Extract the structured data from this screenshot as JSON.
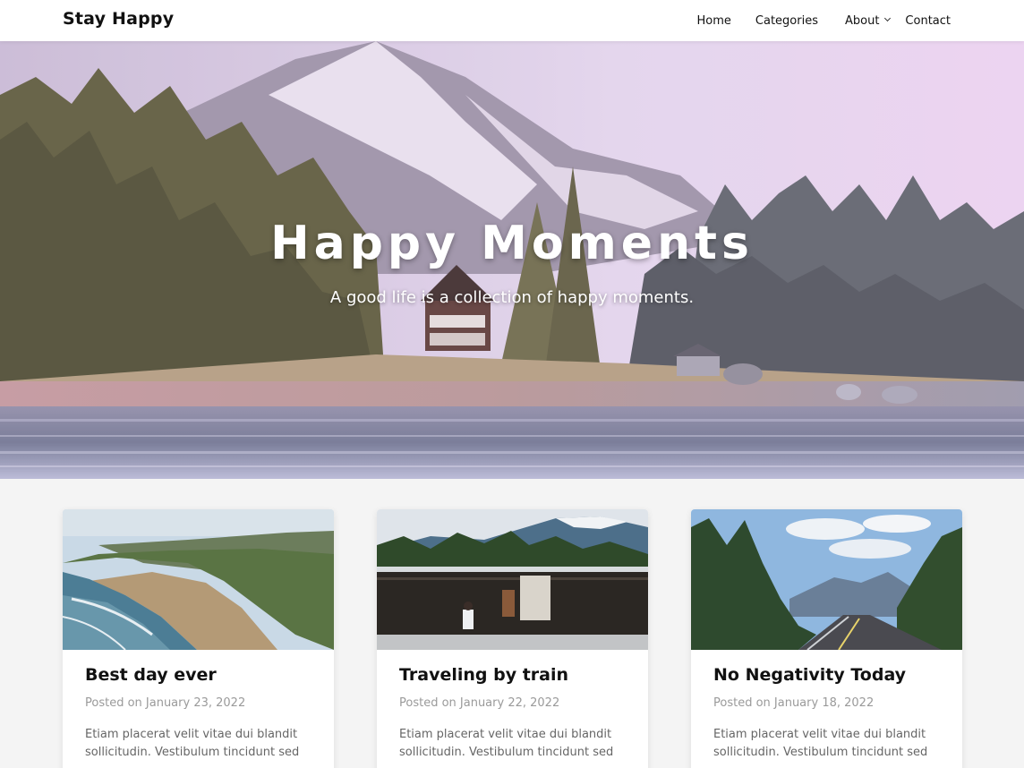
{
  "brand": {
    "name": "Stay Happy"
  },
  "nav": {
    "items": [
      {
        "label": "Home"
      },
      {
        "label": "Categories"
      },
      {
        "label": "About"
      },
      {
        "label": "Contact"
      }
    ]
  },
  "hero": {
    "title": "Happy Moments",
    "subtitle": "A good life is a collection of happy moments."
  },
  "posts": [
    {
      "title": "Best day ever",
      "meta": "Posted on January 23, 2022",
      "excerpt": "Etiam placerat velit vitae dui blandit sollicitudin. Vestibulum tincidunt sed"
    },
    {
      "title": "Traveling by train",
      "meta": "Posted on January 22, 2022",
      "excerpt": "Etiam placerat velit vitae dui blandit sollicitudin. Vestibulum tincidunt sed"
    },
    {
      "title": "No Negativity Today",
      "meta": "Posted on January 18, 2022",
      "excerpt": "Etiam placerat velit vitae dui blandit sollicitudin. Vestibulum tincidunt sed"
    }
  ],
  "colors": {
    "navbar_bg": "#ffffff",
    "page_bg": "#f4f4f4",
    "meta_text": "#9a9a9a",
    "excerpt_text": "#666666"
  },
  "icons": {
    "about_dropdown": "chevron-down-icon"
  }
}
